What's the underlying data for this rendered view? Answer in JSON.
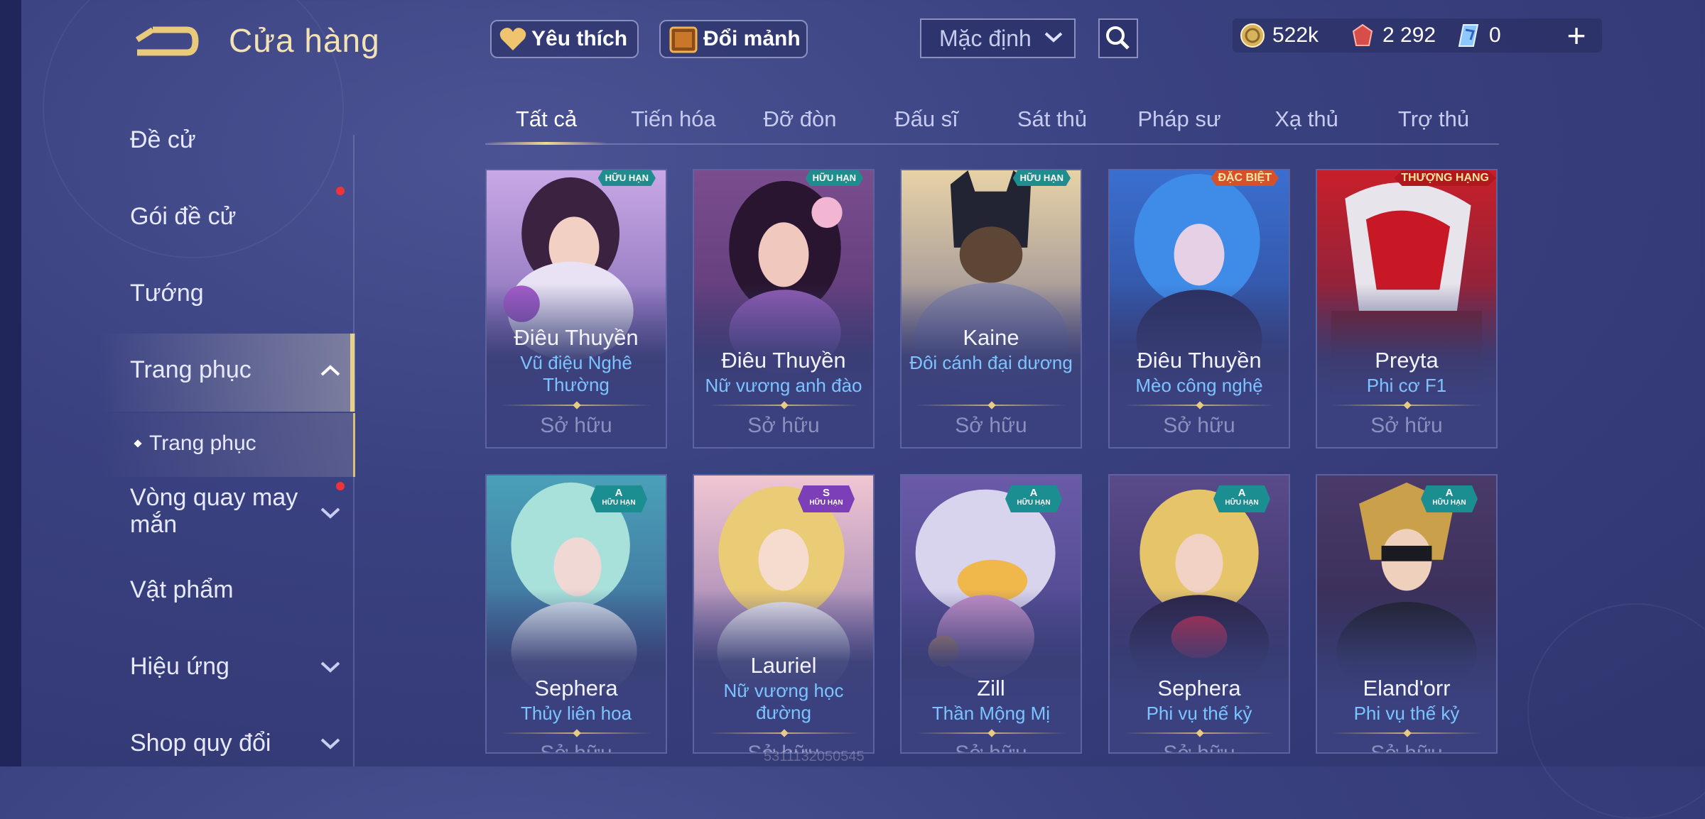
{
  "header": {
    "title": "Cửa hàng",
    "favorites_label": "Yêu thích",
    "shards_label": "Đổi mảnh",
    "sort_value": "Mặc định",
    "currencies": {
      "gold": "522k",
      "voucher": "2 292",
      "gem": "0"
    }
  },
  "sidebar": {
    "items": [
      {
        "label": "Đề cử"
      },
      {
        "label": "Gói đề cử"
      },
      {
        "label": "Tướng"
      },
      {
        "label": "Trang phục"
      },
      {
        "label": "Trang phục"
      },
      {
        "label": "Vòng quay may mắn"
      },
      {
        "label": "Vật phẩm"
      },
      {
        "label": "Hiệu ứng"
      },
      {
        "label": "Shop quy đổi"
      }
    ]
  },
  "tabs": [
    "Tất cả",
    "Tiến hóa",
    "Đỡ đòn",
    "Đấu sĩ",
    "Sát thủ",
    "Pháp sư",
    "Xạ thủ",
    "Trợ thủ"
  ],
  "cards": [
    {
      "hero": "Điêu Thuyền",
      "skin": "Vũ điệu Nghê Thường",
      "status": "Sở hữu",
      "badge": "HỮU HẠN"
    },
    {
      "hero": "Điêu Thuyền",
      "skin": "Nữ vương anh đào",
      "status": "Sở hữu",
      "badge": "HỮU HẠN"
    },
    {
      "hero": "Kaine",
      "skin": "Đôi cánh đại dương",
      "status": "Sở hữu",
      "badge": "HỮU HẠN"
    },
    {
      "hero": "Điêu Thuyền",
      "skin": "Mèo công nghệ",
      "status": "Sở hữu",
      "badge": "ĐẶC BIỆT"
    },
    {
      "hero": "Preyta",
      "skin": "Phi cơ F1",
      "status": "Sở hữu",
      "badge": "THƯỢNG HẠNG"
    },
    {
      "hero": "Sephera",
      "skin": "Thủy liên hoa",
      "status": "Sở hữu",
      "tier": "A",
      "badge": "HỮU HẠN"
    },
    {
      "hero": "Lauriel",
      "skin": "Nữ vương học đường",
      "status": "Sở hữu",
      "tier": "S",
      "badge": "HỮU HẠN"
    },
    {
      "hero": "Zill",
      "skin": "Thần Mộng Mị",
      "status": "Sở hữu",
      "tier": "A",
      "badge": "HỮU HẠN"
    },
    {
      "hero": "Sephera",
      "skin": "Phi vụ thế kỷ",
      "status": "Sở hữu",
      "tier": "A",
      "badge": "HỮU HẠN"
    },
    {
      "hero": "Eland'orr",
      "skin": "Phi vụ thế kỷ",
      "status": "Sở hữu",
      "tier": "A",
      "badge": "HỮU HẠN"
    }
  ],
  "watermark": "5311132050545",
  "icons": {
    "back": "back-arrow-icon",
    "heart": "heart-icon",
    "shards": "shard-chest-icon",
    "search": "search-icon",
    "gold": "gold-coin-icon",
    "voucher": "voucher-icon",
    "gem": "gem-icon",
    "add": "plus-icon"
  },
  "colors": {
    "accent_gold": "#f5d98f",
    "skin_name": "#7bc4ff",
    "notification": "#f0323a"
  }
}
